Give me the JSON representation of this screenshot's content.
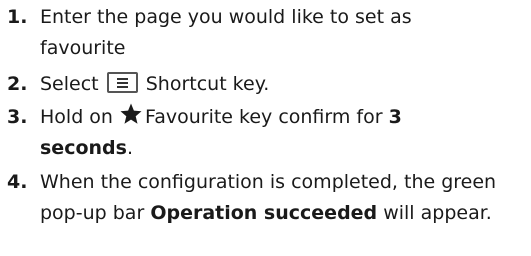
{
  "steps": [
    {
      "number": "1.",
      "text": "Enter the page you would like to set as favourite"
    },
    {
      "number": "2.",
      "before": "Select",
      "icon": "menu-icon",
      "after": "Shortcut key."
    },
    {
      "number": "3.",
      "before": "Hold on",
      "icon": "star-icon",
      "mid": "Favourite key confirm for",
      "bold": "3 seconds",
      "after": "."
    },
    {
      "number": "4.",
      "before": "When the configuration is completed, the green pop-up bar",
      "bold": "Operation succeeded",
      "after": "will appear."
    }
  ],
  "colors": {
    "text": "#1a1a1a",
    "icon_border": "#555555"
  }
}
